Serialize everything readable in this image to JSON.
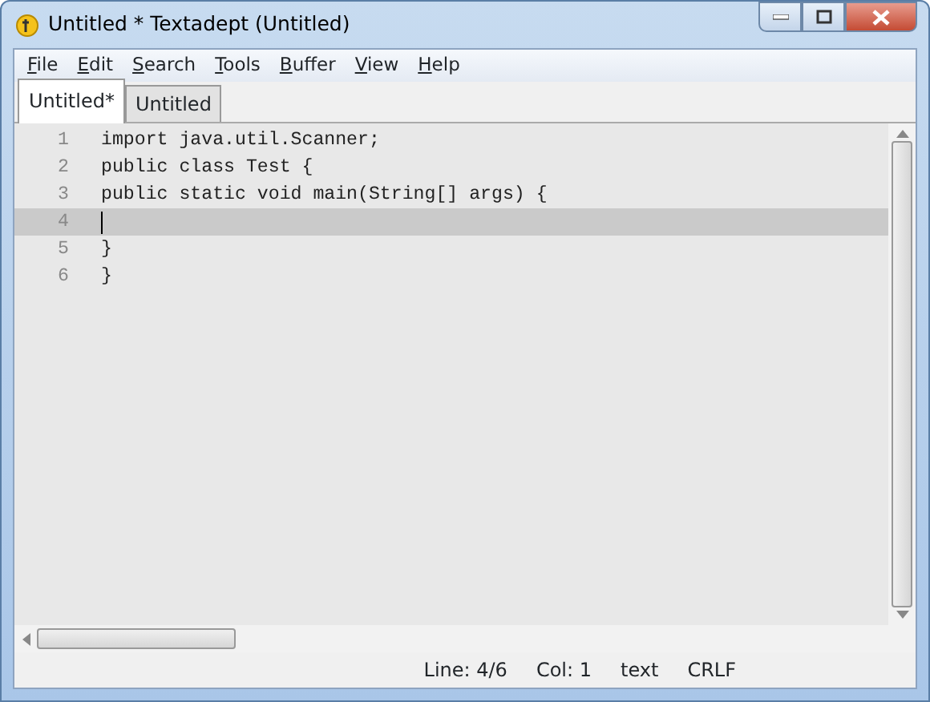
{
  "window": {
    "title": "Untitled * Textadept (Untitled)"
  },
  "menu": [
    "File",
    "Edit",
    "Search",
    "Tools",
    "Buffer",
    "View",
    "Help"
  ],
  "tabs": [
    {
      "label": "Untitled*",
      "selected": true
    },
    {
      "label": "Untitled",
      "selected": false
    }
  ],
  "editor": {
    "lines": [
      {
        "number": "1",
        "text": "import java.util.Scanner;",
        "current": false
      },
      {
        "number": "2",
        "text": "public class Test {",
        "current": false
      },
      {
        "number": "3",
        "text": "public static void main(String[] args) {",
        "current": false
      },
      {
        "number": "4",
        "current": true
      },
      {
        "number": "5",
        "text": "}",
        "current": false
      },
      {
        "number": "6",
        "text": "}",
        "current": false
      }
    ]
  },
  "status_bar": [
    "Line: 4/6",
    "Col: 1",
    "text",
    "CRLF"
  ]
}
